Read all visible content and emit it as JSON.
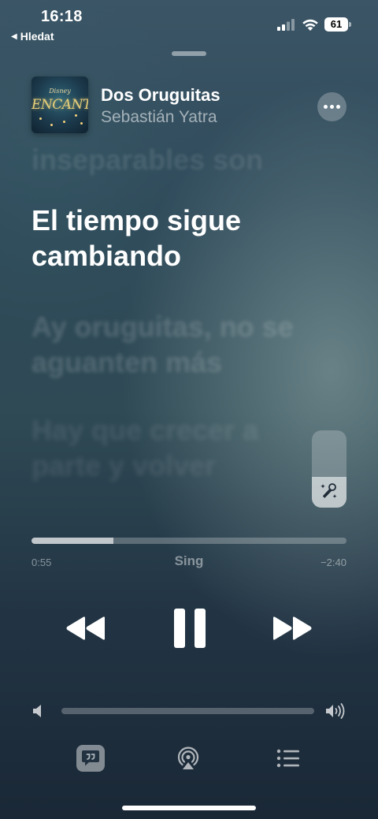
{
  "status_bar": {
    "time": "16:18",
    "back_label": "Hledat",
    "battery": "61"
  },
  "now_playing": {
    "album_art_brand": "Disney",
    "album_art_title": "ENCANTO",
    "song_title": "Dos Oruguitas",
    "artist": "Sebastián Yatra",
    "more_icon": "ellipsis-icon"
  },
  "lyrics": {
    "previous": "inseparables son",
    "current": "El tiempo sigue cambiando",
    "next": "Ay oruguitas, no se aguanten más",
    "next2": "Hay que crecer a parte y volver"
  },
  "sing": {
    "label": "Sing",
    "vocal_level": 0.4
  },
  "playback": {
    "elapsed": "0:55",
    "remaining": "−2:40",
    "progress": 0.26,
    "state": "playing"
  },
  "volume": {
    "level": 0.0
  },
  "icons": {
    "rewind": "rewind-icon",
    "pause": "pause-icon",
    "forward": "fast-forward-icon",
    "lyrics": "lyrics-bubble-icon",
    "airplay": "airplay-icon",
    "queue": "queue-list-icon"
  }
}
